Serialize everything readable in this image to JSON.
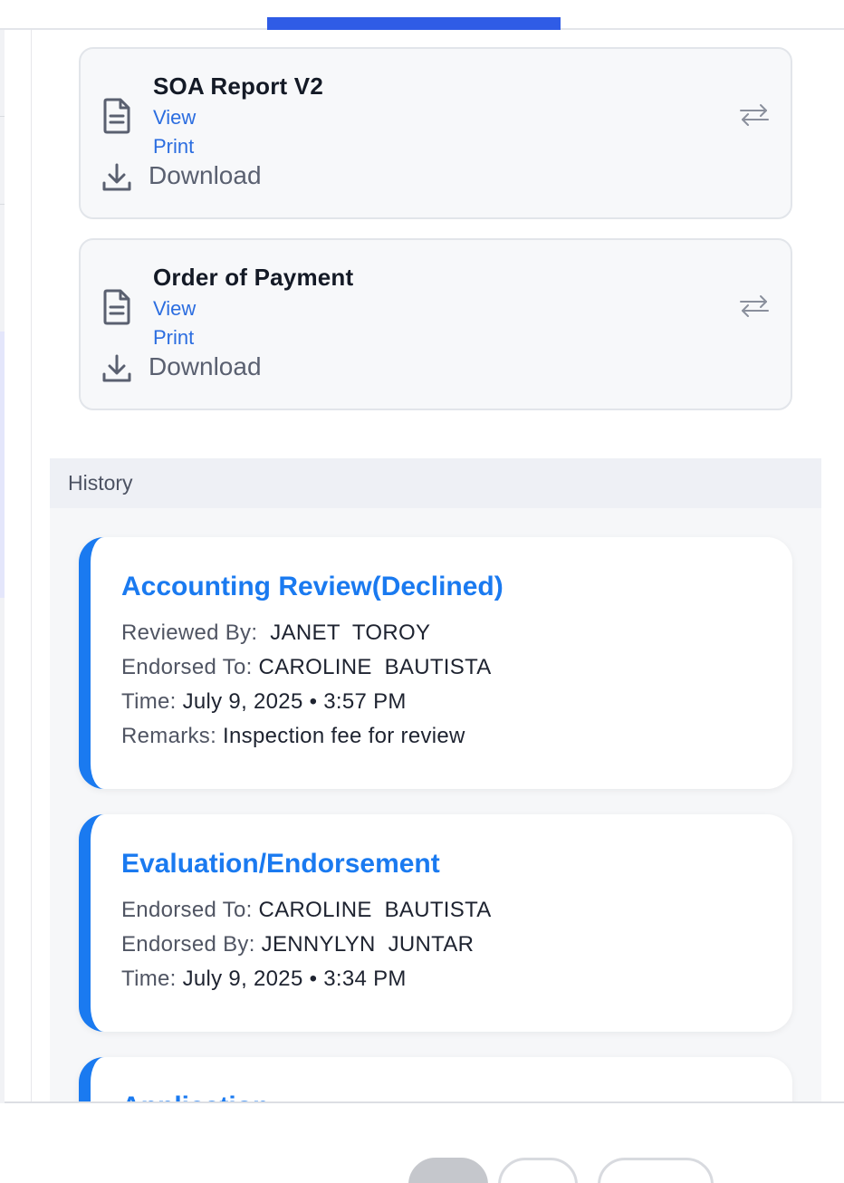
{
  "documents": [
    {
      "title": "SOA Report V2",
      "view_label": "View",
      "print_label": "Print",
      "download_label": "Download",
      "icon": "file-text-icon",
      "download_icon": "download-icon",
      "action_icon": "swap-arrows-icon"
    },
    {
      "title": "Order of Payment",
      "view_label": "View",
      "print_label": "Print",
      "download_label": "Download",
      "icon": "file-text-icon",
      "download_icon": "download-icon",
      "action_icon": "swap-arrows-icon"
    }
  ],
  "history": {
    "title": "History",
    "entries": [
      {
        "title": "Accounting Review(Declined)",
        "lines": [
          {
            "label": "Reviewed By:",
            "value": "  JANET  TOROY"
          },
          {
            "label": "Endorsed To:",
            "value": " CAROLINE  BAUTISTA"
          },
          {
            "label": "Time:",
            "value": " July 9, 2025 • 3:57 PM"
          },
          {
            "label": "Remarks:",
            "value": " Inspection fee for review"
          }
        ]
      },
      {
        "title": "Evaluation/Endorsement",
        "lines": [
          {
            "label": "Endorsed To:",
            "value": " CAROLINE  BAUTISTA"
          },
          {
            "label": "Endorsed By:",
            "value": " JENNYLYN  JUNTAR"
          },
          {
            "label": "Time:",
            "value": " July 9, 2025 • 3:34 PM"
          }
        ]
      },
      {
        "title": "Application",
        "lines": []
      }
    ]
  },
  "colors": {
    "accent": "#1a7af0",
    "link": "#2b6de0",
    "tab_indicator": "#2f5ce6"
  }
}
